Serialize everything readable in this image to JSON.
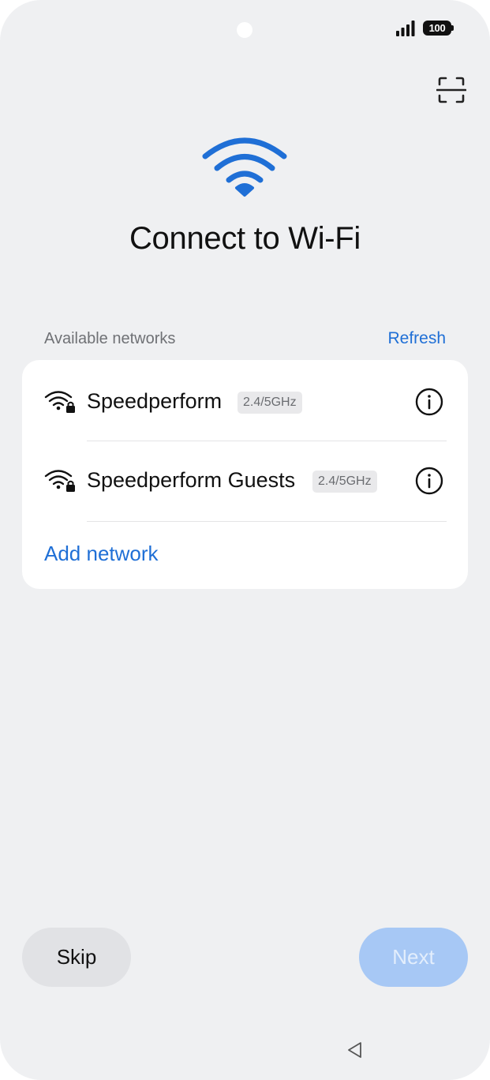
{
  "status_bar": {
    "battery_level": "100",
    "signal_icon": "signal-bars-icon",
    "camera": "camera-cutout"
  },
  "header": {
    "scan_icon": "qr-scan-icon",
    "hero_icon": "wifi-icon",
    "title": "Connect to Wi-Fi"
  },
  "networks": {
    "section_label": "Available networks",
    "refresh_label": "Refresh",
    "items": [
      {
        "name": "Speedperform",
        "band": "2.4/5GHz",
        "icon": "wifi-locked-icon",
        "info_icon": "info-icon"
      },
      {
        "name": "Speedperform Guests",
        "band": "2.4/5GHz",
        "icon": "wifi-locked-icon",
        "info_icon": "info-icon"
      }
    ],
    "add_label": "Add network"
  },
  "footer": {
    "skip_label": "Skip",
    "next_label": "Next",
    "next_enabled": false
  },
  "nav_bar": {
    "back_icon": "back-triangle-icon"
  },
  "colors": {
    "accent": "#1f6fd6",
    "background": "#eff0f2",
    "card": "#ffffff",
    "next_disabled": "#a7c8f5",
    "skip_bg": "#e1e2e5"
  }
}
